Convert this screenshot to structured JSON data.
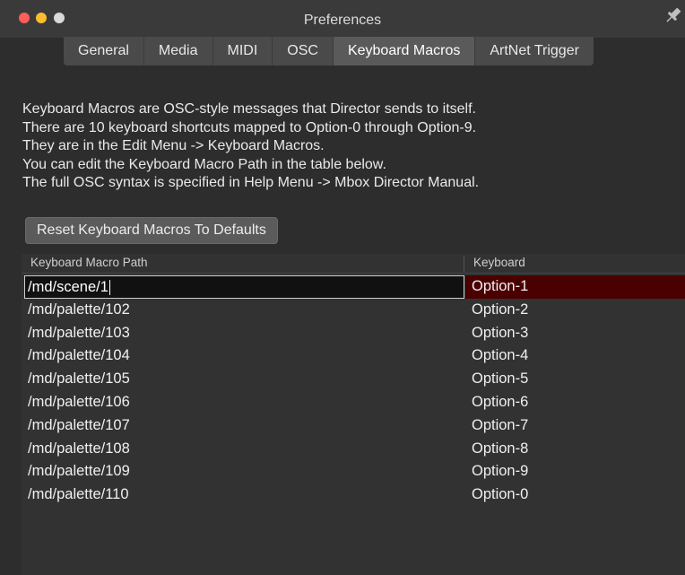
{
  "window": {
    "title": "Preferences"
  },
  "tabs": [
    {
      "label": "General",
      "active": false
    },
    {
      "label": "Media",
      "active": false
    },
    {
      "label": "MIDI",
      "active": false
    },
    {
      "label": "OSC",
      "active": false
    },
    {
      "label": "Keyboard Macros",
      "active": true
    },
    {
      "label": "ArtNet Trigger",
      "active": false
    }
  ],
  "description": [
    "Keyboard Macros are OSC-style messages that Director sends to itself.",
    "There are 10 keyboard shortcuts mapped to Option-0 through Option-9.",
    "They are in the Edit Menu -> Keyboard Macros.",
    "You can edit the Keyboard Macro Path in the table below.",
    "The full OSC syntax is specified in Help Menu -> Mbox Director Manual."
  ],
  "reset_button": {
    "label": "Reset Keyboard Macros To Defaults"
  },
  "table": {
    "columns": [
      "Keyboard Macro Path",
      "Keyboard"
    ],
    "rows": [
      {
        "path": "/md/scene/1",
        "key": "Option-1"
      },
      {
        "path": "/md/palette/102",
        "key": "Option-2"
      },
      {
        "path": "/md/palette/103",
        "key": "Option-3"
      },
      {
        "path": "/md/palette/104",
        "key": "Option-4"
      },
      {
        "path": "/md/palette/105",
        "key": "Option-5"
      },
      {
        "path": "/md/palette/106",
        "key": "Option-6"
      },
      {
        "path": "/md/palette/107",
        "key": "Option-7"
      },
      {
        "path": "/md/palette/108",
        "key": "Option-8"
      },
      {
        "path": "/md/palette/109",
        "key": "Option-9"
      },
      {
        "path": "/md/palette/110",
        "key": "Option-0"
      }
    ],
    "selected_row": 0
  },
  "colors": {
    "selection": "#4a0000",
    "background": "#2d2d2d"
  },
  "icons": [
    "close-icon",
    "minimize-icon",
    "maximize-icon",
    "pin-icon"
  ]
}
